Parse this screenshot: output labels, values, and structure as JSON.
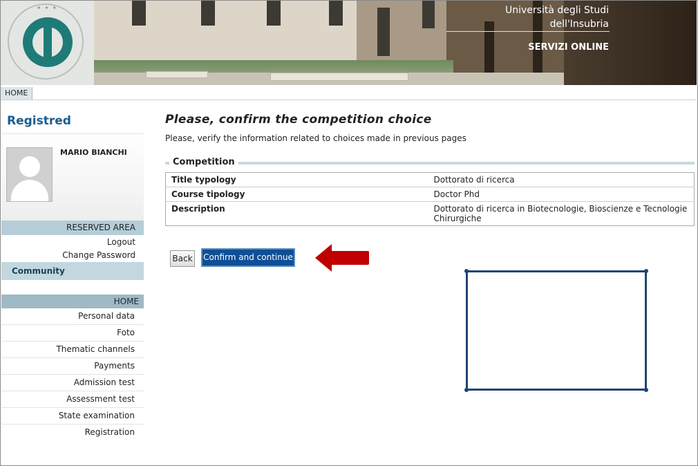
{
  "header": {
    "university_line1": "Università degli Studi",
    "university_line2": "dell'Insubria",
    "services": "SERVIZI ONLINE",
    "seal_text": "UNIVERSITAS STUDIORUM INSUBRIAE"
  },
  "nav": {
    "home_tab": "HOME"
  },
  "sidebar": {
    "title": "Registred",
    "user_name": "MARIO BIANCHI",
    "reserved_area": {
      "heading": "RESERVED AREA",
      "links": [
        "Logout",
        "Change Password"
      ]
    },
    "community": "Community",
    "home_heading": "HOME",
    "menu": [
      "Personal data",
      "Foto",
      "Thematic channels",
      "Payments",
      "Admission test",
      "Assessment test",
      "State examination",
      "Registration"
    ]
  },
  "main": {
    "title": "Please, confirm the competition choice",
    "subtitle": "Please, verify the information related to choices made in previous pages",
    "competition": {
      "legend": "Competition",
      "rows": [
        {
          "label": "Title typology",
          "value": "Dottorato di ricerca"
        },
        {
          "label": "Course tipology",
          "value": "Doctor Phd"
        },
        {
          "label": "Description",
          "value": "Dottorato di ricerca in Biotecnologie, Bioscienze e Tecnologie Chirurgiche"
        }
      ]
    },
    "buttons": {
      "back": "Back",
      "confirm": "Confirm and continue"
    }
  },
  "annotations": {
    "arrow_color": "#c00000",
    "box_color": "#1e4373"
  }
}
